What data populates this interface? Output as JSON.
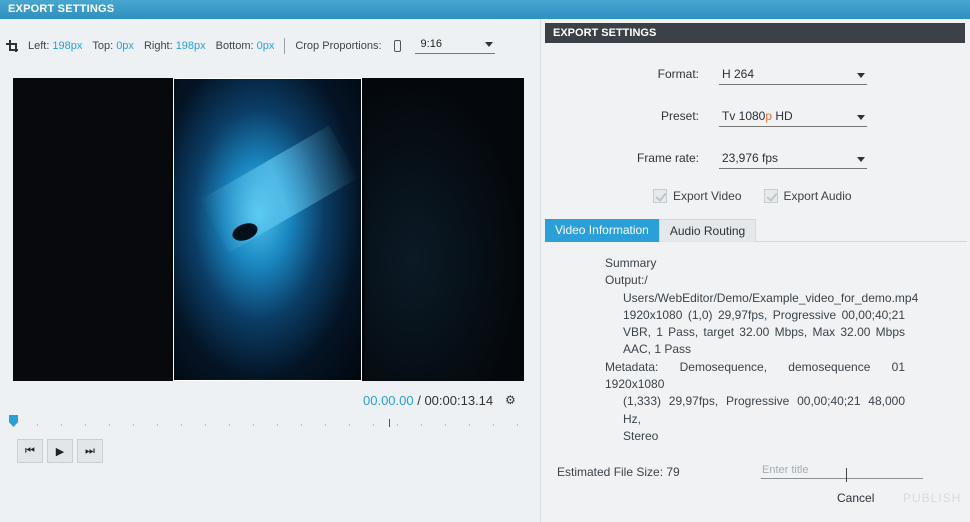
{
  "window": {
    "title": "EXPORT SETTINGS"
  },
  "crop": {
    "left_label": "Left:",
    "left_value": "198px",
    "top_label": "Top:",
    "top_value": "0px",
    "right_label": "Right:",
    "right_value": "198px",
    "bottom_label": "Bottom:",
    "bottom_value": "0px",
    "proportions_label": "Crop Proportions:",
    "proportions_value": "9:16"
  },
  "player": {
    "current_time": "00.00.00",
    "separator": " / ",
    "total_time": "00:00:13.14"
  },
  "export": {
    "header": "EXPORT SETTINGS",
    "format_label": "Format:",
    "format_value": "H 264",
    "preset_label": "Preset:",
    "preset_prefix": "Tv 1080",
    "preset_highlight": "p",
    "preset_suffix": " HD",
    "framerate_label": "Frame rate:",
    "framerate_value": "23,976 fps",
    "export_video_label": "Export Video",
    "export_audio_label": "Export Audio"
  },
  "tabs": [
    {
      "label": "Video Information",
      "active": true
    },
    {
      "label": "Audio Routing",
      "active": false
    }
  ],
  "info": {
    "summary": "Summary",
    "output_label": "Output:/",
    "lines": [
      "Users/WebEditor/Demo/Example_video_for_demo.mp4",
      "1920x1080 (1,0) 29,97fps, Progressive 00,00;40;21",
      "VBR, 1 Pass, target 32.00 Mbps, Max 32.00 Mbps",
      "AAC, 1 Pass"
    ],
    "metadata_line": "Metadata: Demosequence, demosequence 01 1920x1080",
    "metadata_cont": [
      "(1,333) 29,97fps, Progressive 00,00;40;21 48,000 Hz,",
      "Stereo"
    ]
  },
  "footer": {
    "filesize_label": "Estimated File Size: 79",
    "title_placeholder": "Enter title",
    "cancel_label": "Cancel",
    "publish_label": "PUBLISH"
  }
}
